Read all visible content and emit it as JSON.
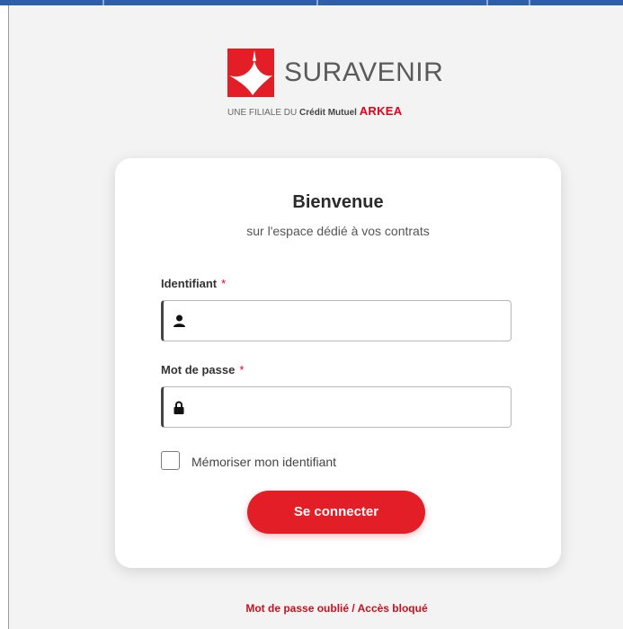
{
  "brand": {
    "name": "SURAVENIR",
    "tagline_prefix": "UNE FILIALE DU",
    "tagline_group": "Crédit Mutuel",
    "tagline_arkea": "ARKEA",
    "logo_icon": "suravenir-logo-icon"
  },
  "login": {
    "title": "Bienvenue",
    "subtitle": "sur l'espace dédié à vos contrats",
    "username_label": "Identifiant",
    "username_value": "",
    "username_icon": "user-icon",
    "password_label": "Mot de passe",
    "password_value": "",
    "password_icon": "lock-icon",
    "required_marker": "*",
    "remember_label": "Mémoriser mon identifiant",
    "remember_checked": false,
    "submit_label": "Se connecter"
  },
  "footer": {
    "forgot_link": "Mot de passe oublié / Accès bloqué"
  },
  "colors": {
    "accent": "#e41e26",
    "background": "#f3f3f3",
    "card": "#ffffff",
    "top_bar": "#2f5fa8"
  }
}
